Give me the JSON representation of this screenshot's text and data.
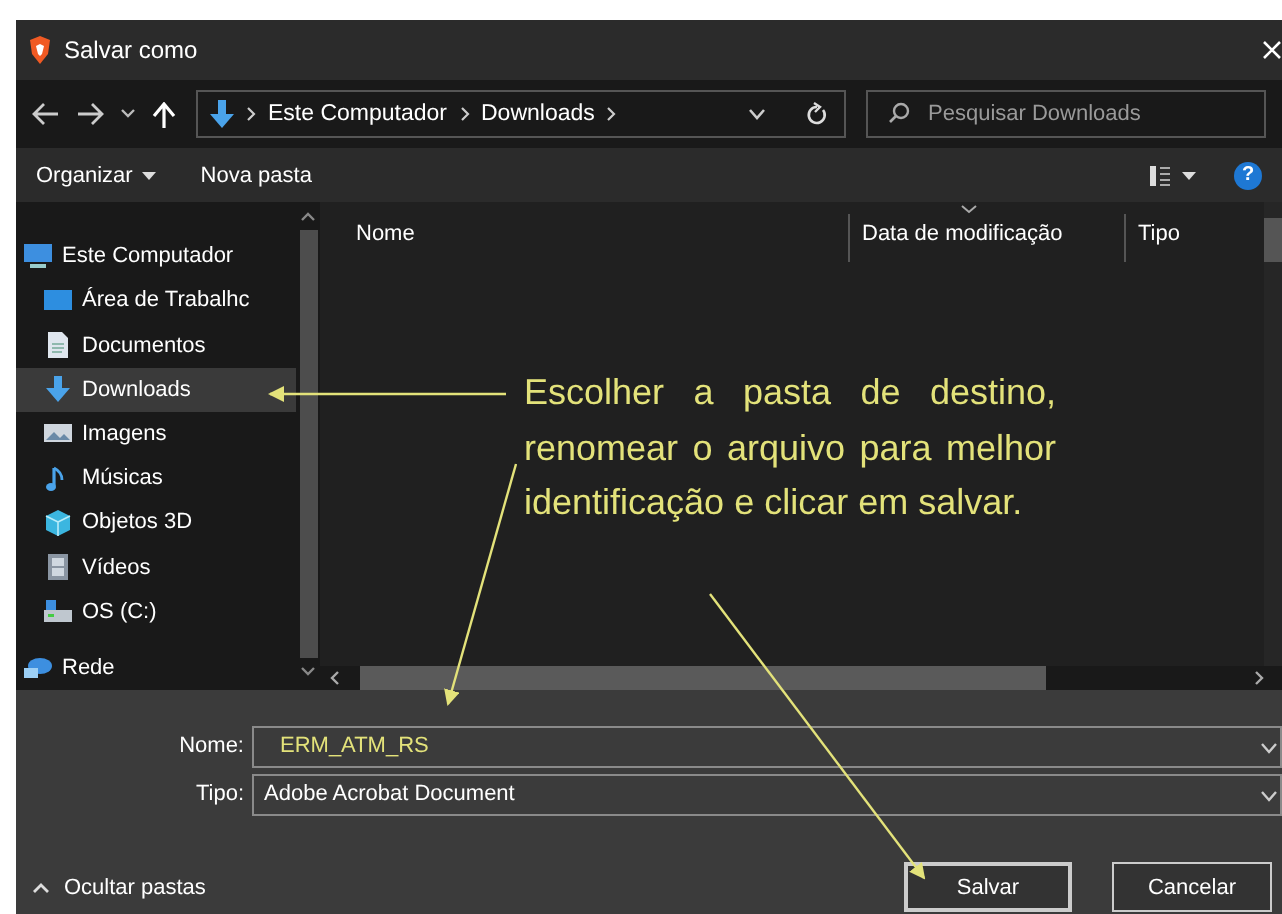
{
  "window": {
    "title": "Salvar como"
  },
  "address_bar": {
    "path": [
      "Este Computador",
      "Downloads"
    ]
  },
  "search": {
    "placeholder": "Pesquisar Downloads"
  },
  "toolbar": {
    "buttons": [
      {
        "label": "Organizar",
        "kind": "menu"
      },
      {
        "label": "Nova pasta",
        "kind": "plain"
      }
    ],
    "help": "?"
  },
  "sidebar": {
    "items": [
      {
        "label": "Este Computador",
        "kind": "computer",
        "selected": false,
        "children": [
          {
            "label": "Área de Trabalhc",
            "kind": "desktop",
            "selected": false
          },
          {
            "label": "Documentos",
            "kind": "document",
            "selected": false
          },
          {
            "label": "Downloads",
            "kind": "download",
            "selected": true
          },
          {
            "label": "Imagens",
            "kind": "pictures",
            "selected": false
          },
          {
            "label": "Músicas",
            "kind": "music",
            "selected": false
          },
          {
            "label": "Objetos 3D",
            "kind": "cube",
            "selected": false
          },
          {
            "label": "Vídeos",
            "kind": "film",
            "selected": false
          },
          {
            "label": "OS (C:)",
            "kind": "drive",
            "selected": false
          }
        ]
      },
      {
        "label": "Rede",
        "kind": "network",
        "selected": false
      }
    ]
  },
  "table": {
    "columns": [
      "Nome",
      "Data de modificação",
      "Tipo"
    ]
  },
  "form": {
    "fields": [
      {
        "label": "Nome:",
        "value": "ERM_ATM_RS"
      },
      {
        "label": "Tipo:",
        "value": "Adobe Acrobat Document"
      }
    ]
  },
  "hide_folders": {
    "label": "Ocultar pastas"
  },
  "buttons": [
    {
      "label": "Salvar",
      "kind": "default"
    },
    {
      "label": "Cancelar",
      "kind": "normal"
    }
  ],
  "annotation": {
    "text": "Escolher a pasta de destino, renomear o arquivo para melhor identificação e clicar em salvar."
  }
}
